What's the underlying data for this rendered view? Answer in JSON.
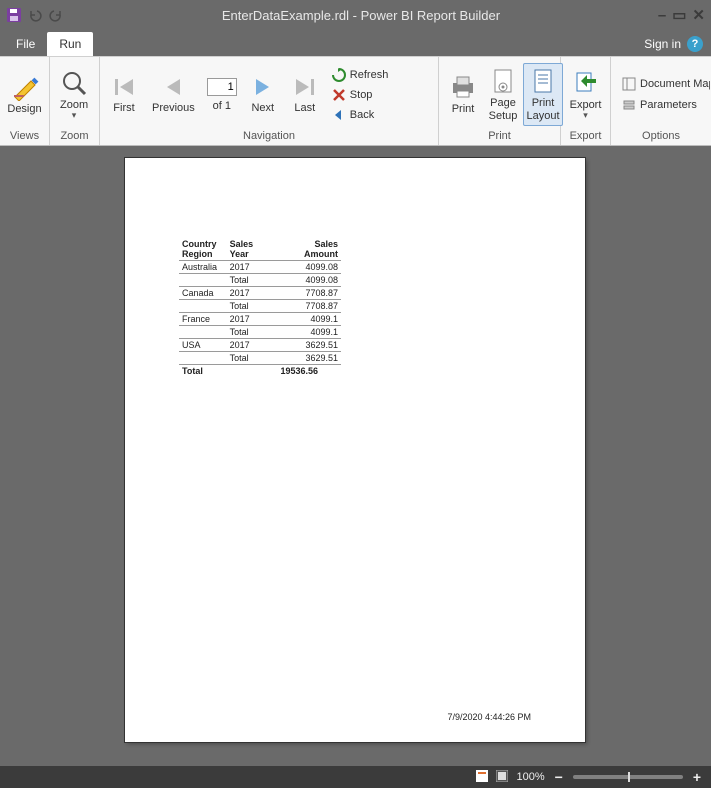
{
  "window": {
    "title": "EnterDataExample.rdl - Power BI Report Builder"
  },
  "tabs": {
    "file": "File",
    "run": "Run",
    "signin": "Sign in"
  },
  "ribbon": {
    "views": {
      "group": "Views",
      "design": "Design"
    },
    "zoom": {
      "group": "Zoom",
      "zoom": "Zoom"
    },
    "navigation": {
      "group": "Navigation",
      "first": "First",
      "previous": "Previous",
      "next": "Next",
      "last": "Last",
      "refresh": "Refresh",
      "stop": "Stop",
      "back": "Back",
      "page_current": "1",
      "page_of": "of  1"
    },
    "print": {
      "group": "Print",
      "print": "Print",
      "page_setup": "Page\nSetup",
      "print_layout": "Print\nLayout"
    },
    "export": {
      "group": "Export",
      "export": "Export"
    },
    "options": {
      "group": "Options",
      "document_map": "Document Map",
      "parameters": "Parameters"
    }
  },
  "report": {
    "headers": {
      "country": "Country Region",
      "year": "Sales Year",
      "amount": "Sales Amount"
    },
    "rows": [
      {
        "c1": "Australia",
        "c2": "2017",
        "c3": "4099.08"
      },
      {
        "c1": "",
        "c2": "Total",
        "c3": "4099.08"
      },
      {
        "c1": "Canada",
        "c2": "2017",
        "c3": "7708.87"
      },
      {
        "c1": "",
        "c2": "Total",
        "c3": "7708.87"
      },
      {
        "c1": "France",
        "c2": "2017",
        "c3": "4099.1"
      },
      {
        "c1": "",
        "c2": "Total",
        "c3": "4099.1"
      },
      {
        "c1": "USA",
        "c2": "2017",
        "c3": "3629.51"
      },
      {
        "c1": "",
        "c2": "Total",
        "c3": "3629.51"
      }
    ],
    "grand_label": "Total",
    "grand_value": "19536.56",
    "timestamp": "7/9/2020 4:44:26 PM"
  },
  "status": {
    "zoom": "100%"
  }
}
